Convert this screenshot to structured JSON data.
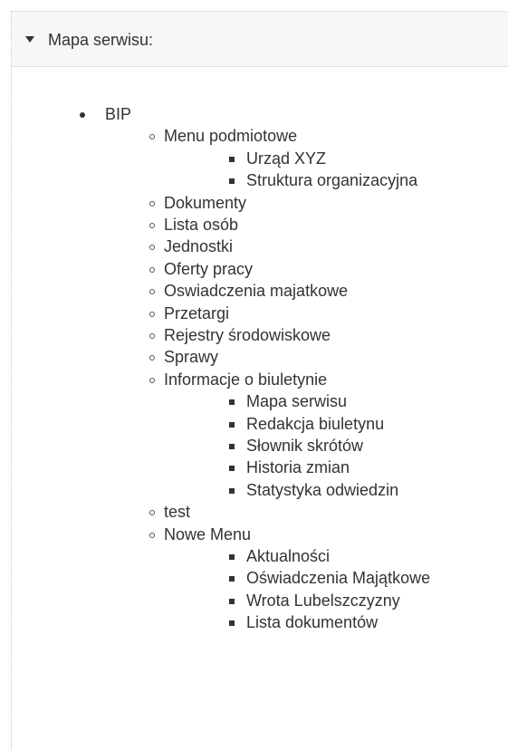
{
  "panel": {
    "title": "Mapa serwisu:",
    "toggle_icon": "caret-down-icon"
  },
  "tree": {
    "root": "BIP",
    "items": [
      {
        "label": "Menu podmiotowe",
        "children": [
          "Urząd XYZ",
          "Struktura organizacyjna"
        ]
      },
      {
        "label": "Dokumenty"
      },
      {
        "label": "Lista osób"
      },
      {
        "label": "Jednostki"
      },
      {
        "label": "Oferty pracy"
      },
      {
        "label": "Oswiadczenia majatkowe"
      },
      {
        "label": "Przetargi"
      },
      {
        "label": "Rejestry środowiskowe"
      },
      {
        "label": "Sprawy"
      },
      {
        "label": "Informacje o biuletynie",
        "children": [
          "Mapa serwisu",
          "Redakcja biuletynu",
          "Słownik skrótów",
          "Historia zmian",
          "Statystyka odwiedzin"
        ]
      },
      {
        "label": "test"
      },
      {
        "label": "Nowe Menu",
        "children": [
          "Aktualności",
          "Oświadczenia Majątkowe",
          "Wrota Lubelszczyzny",
          "Lista dokumentów"
        ]
      }
    ]
  }
}
